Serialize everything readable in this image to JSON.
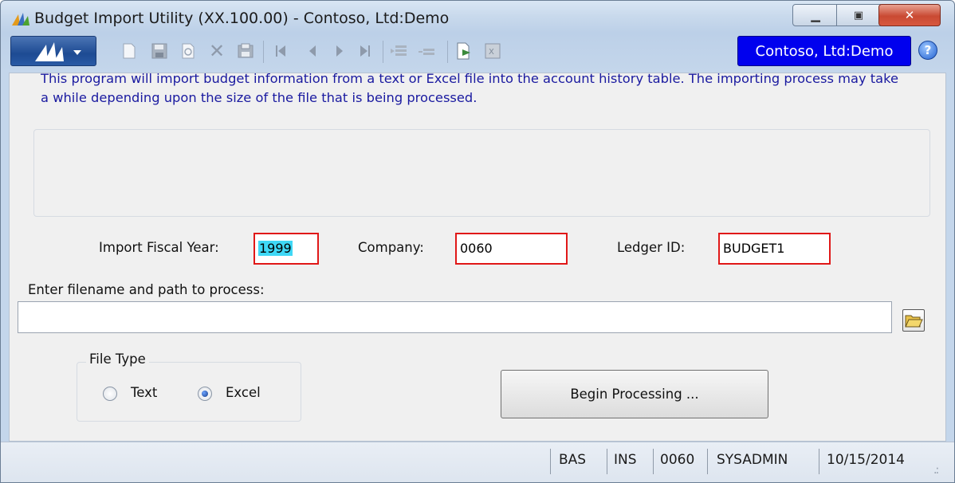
{
  "window": {
    "title": "Budget Import Utility (XX.100.00) - Contoso, Ltd:Demo",
    "controls": {
      "minimize": "▭",
      "maximize": "◻",
      "close": "✕"
    }
  },
  "toolbar": {
    "icons": [
      "new-icon",
      "save-icon",
      "refresh-icon",
      "delete-icon",
      "print-icon",
      "first-icon",
      "previous-icon",
      "next-icon",
      "last-icon",
      "insert-row-icon",
      "delete-row-icon",
      "export-icon",
      "excel-icon"
    ],
    "company_badge": "Contoso, Ltd:Demo",
    "help": "?"
  },
  "info": {
    "text": "This program will import budget information from a text or Excel file into the account history table.  The importing process may take a while depending upon the size of the file that is being processed."
  },
  "form": {
    "fiscal_year_label": "Import Fiscal Year:",
    "fiscal_year_value": "1999",
    "company_label": "Company:",
    "company_value": "0060",
    "ledger_label": "Ledger ID:",
    "ledger_value": "BUDGET1",
    "filename_label": "Enter filename and path to process:",
    "filename_value": ""
  },
  "file_type": {
    "title": "File Type",
    "options": [
      {
        "label": "Text",
        "selected": false
      },
      {
        "label": "Excel",
        "selected": true
      }
    ]
  },
  "begin_button": "Begin Processing ...",
  "status_bar": {
    "mode": "BAS",
    "insert": "INS",
    "company": "0060",
    "user": "SYSADMIN",
    "date": "10/15/2014"
  },
  "colors": {
    "accent": "#0000ee",
    "required_border": "#e01818",
    "info_text": "#1a1aa0"
  }
}
